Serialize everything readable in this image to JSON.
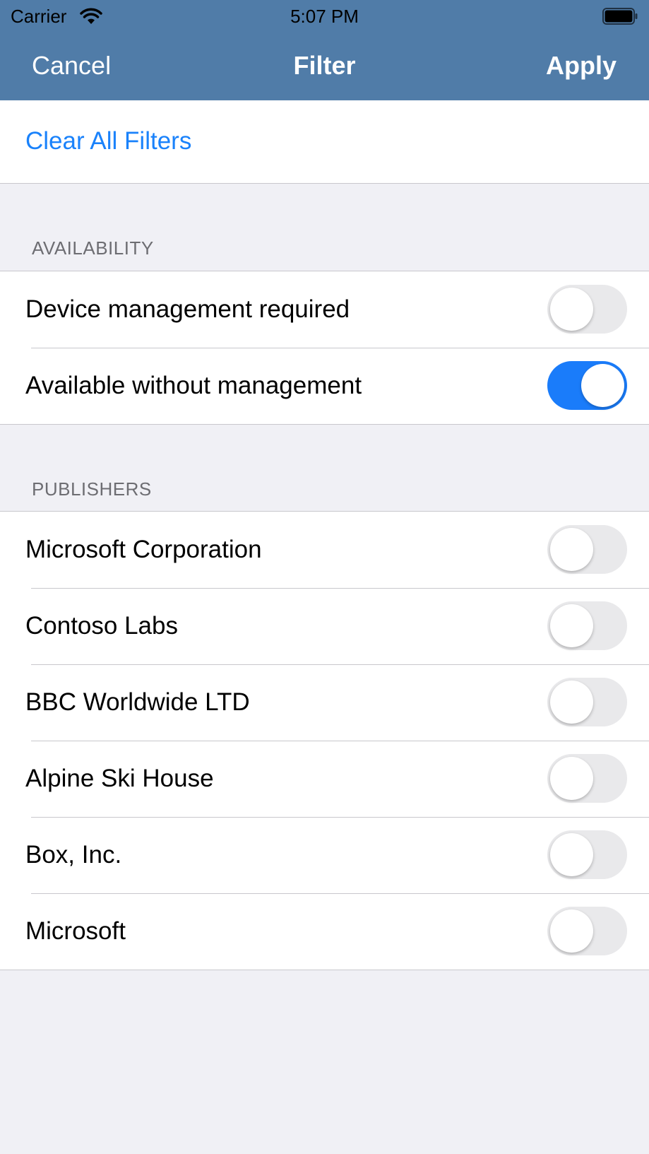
{
  "status_bar": {
    "carrier": "Carrier",
    "time": "5:07 PM"
  },
  "nav": {
    "cancel_label": "Cancel",
    "title": "Filter",
    "apply_label": "Apply",
    "bar_color": "#507ca8"
  },
  "clear_all_label": "Clear All Filters",
  "accent_color": "#1a7cfa",
  "availability": {
    "header": "AVAILABILITY",
    "items": [
      {
        "label": "Device management required",
        "on": false
      },
      {
        "label": "Available without management",
        "on": true
      }
    ]
  },
  "publishers": {
    "header": "PUBLISHERS",
    "items": [
      {
        "label": "Microsoft Corporation",
        "on": false
      },
      {
        "label": "Contoso Labs",
        "on": false
      },
      {
        "label": "BBC Worldwide LTD",
        "on": false
      },
      {
        "label": "Alpine Ski House",
        "on": false
      },
      {
        "label": "Box, Inc.",
        "on": false
      },
      {
        "label": "Microsoft",
        "on": false
      }
    ]
  }
}
